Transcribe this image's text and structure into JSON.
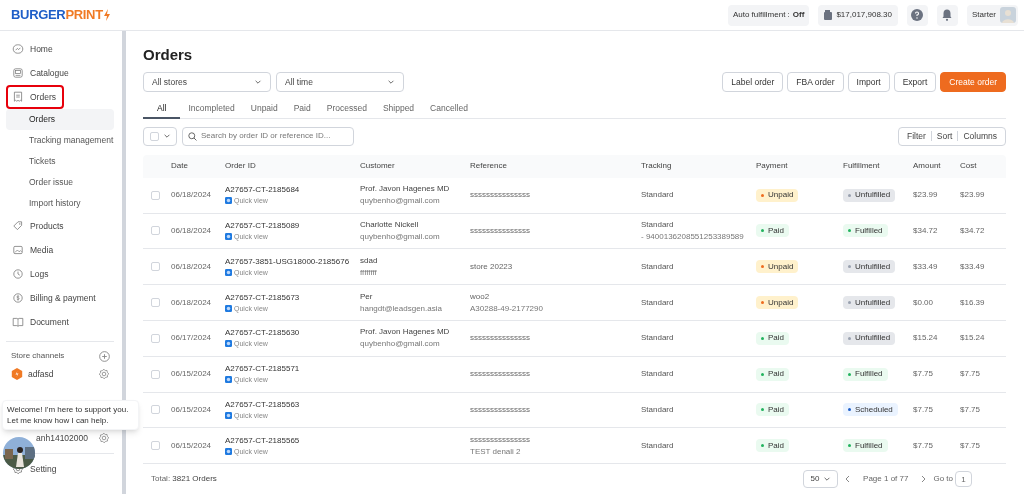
{
  "header": {
    "logo_left": "BURGER",
    "logo_right": "PRINT",
    "auto_fulfillment_label": "Auto fulfillment :",
    "auto_fulfillment_value": "Off",
    "balance": "$17,017,908.30",
    "plan": "Starter"
  },
  "sidebar": {
    "items": [
      {
        "label": "Home",
        "selected": false,
        "outlined": false
      },
      {
        "label": "Catalogue",
        "selected": false,
        "outlined": false
      },
      {
        "label": "Orders",
        "selected": false,
        "outlined": true,
        "children": [
          {
            "label": "Orders",
            "selected": true
          },
          {
            "label": "Tracking management",
            "selected": false
          },
          {
            "label": "Tickets",
            "selected": false
          },
          {
            "label": "Order issue",
            "selected": false
          },
          {
            "label": "Import history",
            "selected": false
          }
        ]
      },
      {
        "label": "Products",
        "selected": false,
        "outlined": false
      },
      {
        "label": "Media",
        "selected": false,
        "outlined": false
      },
      {
        "label": "Logs",
        "selected": false,
        "outlined": false
      },
      {
        "label": "Billing & payment",
        "selected": false,
        "outlined": false
      },
      {
        "label": "Document",
        "selected": false,
        "outlined": false
      }
    ],
    "store_channels_title": "Store channels",
    "stores": [
      "adfasd"
    ],
    "user": "anh14102000",
    "setting": "Setting",
    "tooltip": "Welcome! I'm here to support you. Let me know how I can help."
  },
  "page": {
    "title": "Orders",
    "store_filter": "All stores",
    "time_filter": "All time",
    "actions": [
      {
        "label": "Label order",
        "kind": "secondary"
      },
      {
        "label": "FBA order",
        "kind": "secondary"
      },
      {
        "label": "Import",
        "kind": "secondary"
      },
      {
        "label": "Export",
        "kind": "secondary"
      },
      {
        "label": "Create order",
        "kind": "primary"
      }
    ],
    "tabs": [
      {
        "label": "All",
        "selected": true
      },
      {
        "label": "Incompleted",
        "selected": false
      },
      {
        "label": "Unpaid",
        "selected": false
      },
      {
        "label": "Paid",
        "selected": false
      },
      {
        "label": "Processed",
        "selected": false
      },
      {
        "label": "Shipped",
        "selected": false
      },
      {
        "label": "Cancelled",
        "selected": false
      }
    ],
    "select_all": {
      "checked": false
    },
    "search": {
      "placeholder": "Search by order ID or reference ID..."
    },
    "tools": [
      "Filter",
      "Sort",
      "Columns"
    ]
  },
  "table": {
    "columns": [
      "Date",
      "Order ID",
      "Customer",
      "Reference",
      "Tracking",
      "Payment",
      "Fulfillment",
      "Amount",
      "Cost"
    ],
    "rows": [
      {
        "checked": false,
        "date": "06/18/2024",
        "order_id": "A27657-CT-2185684",
        "quick_view": "Quick view",
        "customer": [
          "Prof. Javon Hagenes MD",
          "quybenho@gmail.com"
        ],
        "reference": [
          "sssssssssssssss"
        ],
        "tracking": [
          "Standard"
        ],
        "payment": {
          "label": "Unpaid",
          "kind": "unpaid"
        },
        "fulfillment": {
          "label": "Unfulfilled",
          "kind": "unfulfilled"
        },
        "amount": "$23.99",
        "cost": "$23.99"
      },
      {
        "checked": false,
        "date": "06/18/2024",
        "order_id": "A27657-CT-2185089",
        "quick_view": "Quick view",
        "customer": [
          "Charlotte Nickell",
          "quybenho@gmail.com"
        ],
        "reference": [
          "sssssssssssssss"
        ],
        "tracking": [
          "Standard",
          "- 9400136208551253389589"
        ],
        "payment": {
          "label": "Paid",
          "kind": "paid"
        },
        "fulfillment": {
          "label": "Fulfilled",
          "kind": "fulfilled"
        },
        "amount": "$34.72",
        "cost": "$34.72"
      },
      {
        "checked": false,
        "date": "06/18/2024",
        "order_id": "A27657-3851-USG18000-2185676",
        "quick_view": "Quick view",
        "customer": [
          "sdad",
          "ffffffff"
        ],
        "reference": [
          "store 20223"
        ],
        "tracking": [
          "Standard"
        ],
        "payment": {
          "label": "Unpaid",
          "kind": "unpaid"
        },
        "fulfillment": {
          "label": "Unfulfilled",
          "kind": "unfulfilled"
        },
        "amount": "$33.49",
        "cost": "$33.49"
      },
      {
        "checked": false,
        "date": "06/18/2024",
        "order_id": "A27657-CT-2185673",
        "quick_view": "Quick view",
        "customer": [
          "Per",
          "hangdt@leadsgen.asia"
        ],
        "reference": [
          "woo2",
          "A30288-49-2177290"
        ],
        "tracking": [
          "Standard"
        ],
        "payment": {
          "label": "Unpaid",
          "kind": "unpaid"
        },
        "fulfillment": {
          "label": "Unfulfilled",
          "kind": "unfulfilled"
        },
        "amount": "$0.00",
        "cost": "$16.39"
      },
      {
        "checked": false,
        "date": "06/17/2024",
        "order_id": "A27657-CT-2185630",
        "quick_view": "Quick view",
        "customer": [
          "Prof. Javon Hagenes MD",
          "quybenho@gmail.com"
        ],
        "reference": [
          "sssssssssssssss"
        ],
        "tracking": [
          "Standard"
        ],
        "payment": {
          "label": "Paid",
          "kind": "paid"
        },
        "fulfillment": {
          "label": "Unfulfilled",
          "kind": "unfulfilled"
        },
        "amount": "$15.24",
        "cost": "$15.24"
      },
      {
        "checked": false,
        "date": "06/15/2024",
        "order_id": "A27657-CT-2185571",
        "quick_view": "Quick view",
        "customer": [],
        "reference": [
          "sssssssssssssss"
        ],
        "tracking": [
          "Standard"
        ],
        "payment": {
          "label": "Paid",
          "kind": "paid"
        },
        "fulfillment": {
          "label": "Fulfilled",
          "kind": "fulfilled"
        },
        "amount": "$7.75",
        "cost": "$7.75"
      },
      {
        "checked": false,
        "date": "06/15/2024",
        "order_id": "A27657-CT-2185563",
        "quick_view": "Quick view",
        "customer": [],
        "reference": [
          "sssssssssssssss"
        ],
        "tracking": [
          "Standard"
        ],
        "payment": {
          "label": "Paid",
          "kind": "paid"
        },
        "fulfillment": {
          "label": "Scheduled",
          "kind": "scheduled"
        },
        "amount": "$7.75",
        "cost": "$7.75"
      },
      {
        "checked": false,
        "date": "06/15/2024",
        "order_id": "A27657-CT-2185565",
        "quick_view": "Quick view",
        "customer": [],
        "reference": [
          "sssssssssssssss",
          "TEST denali 2"
        ],
        "tracking": [
          "Standard"
        ],
        "payment": {
          "label": "Paid",
          "kind": "paid"
        },
        "fulfillment": {
          "label": "Fulfilled",
          "kind": "fulfilled"
        },
        "amount": "$7.75",
        "cost": "$7.75"
      }
    ]
  },
  "footer": {
    "total_label": "Total:",
    "total_value": "3821 Orders",
    "page_size": "50",
    "page_info": "Page 1 of 77",
    "goto_label": "Go to",
    "goto_value": "1"
  }
}
